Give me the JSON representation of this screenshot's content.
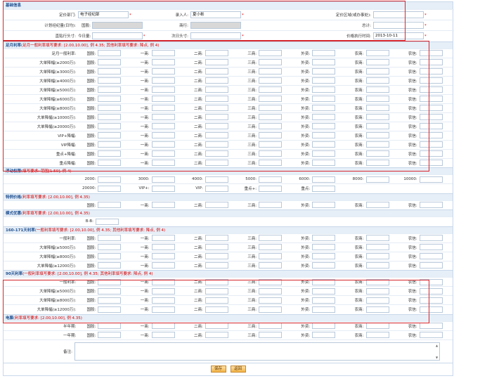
{
  "base": {
    "title": "基础信息",
    "row1": {
      "dept_label": "定价部门:",
      "dept_value": "电子经纪部",
      "entry_label": "录入人:",
      "entry_value": "夏小彬",
      "region_label": "定价区域(或办事处):",
      "region_value": ""
    },
    "row2": {
      "plan_label": "计划经纪量(日均):",
      "country_label": "国股:",
      "city_label": "商行:",
      "total_label": "总计:"
    },
    "row3": {
      "head_label": "直贴行头寸:",
      "today_label": "今日量:",
      "next_label": "次日头寸:",
      "date_label": "价格执行时间:",
      "date_value": "2013-10-11"
    }
  },
  "sections": {
    "month": {
      "title": "足月利率",
      "note": "(足月一般利率填写要求: [2.00,10.00], 例 4.35; 其他利率填写要求: 降点, 例 4)",
      "cols": [
        "国股:",
        "一商:",
        "二商:",
        "三商:",
        "外资:",
        "农商:",
        "农信:"
      ],
      "rows": [
        "足月一般利率:",
        "大单降幅(≥2000万):",
        "大单降幅(≥3000万):",
        "大单降幅(≥4000万):",
        "大单降幅(≥5000万):",
        "大单降幅(≥6000万):",
        "大单降幅(≥8000万):",
        "大单降幅(≥10000万):",
        "大单降幅(≥20000万):",
        "VIP+降幅:",
        "VIP降幅:",
        "重点+降幅:",
        "重点降幅:"
      ]
    },
    "float": {
      "title": "浮动权限",
      "note": "(填写要求: 范围[1.50], 例 4)",
      "row1": [
        "2000:",
        "3000:",
        "4000:",
        "5000:",
        "6000:",
        "8000:",
        "10000:"
      ],
      "row2": [
        "20000:",
        "VIP+:",
        "VIP:",
        "重点+:",
        "重点:"
      ]
    },
    "special": {
      "title": "特例价格",
      "note": "(利率填写要求: [2.00,10.00], 例 4.35)",
      "cols": [
        "国股:",
        "一商:",
        "二商:",
        "三商:",
        "外资:",
        "农商:",
        "农信:"
      ]
    },
    "mode": {
      "title": "模式优惠",
      "note": "(利率填写要求: [2.00,10.00], 例 4.35)",
      "label": "B-B:"
    },
    "d160": {
      "title": "160-171天利率",
      "note": "(一般利率填写要求: [2.00,10.00], 例 4.35; 其他利率填写要求: 降点, 例 4)",
      "cols": [
        "国股:",
        "一商:",
        "二商:",
        "三商:",
        "外资:",
        "农商:",
        "农信:"
      ],
      "rows": [
        "一般利率:",
        "大单降幅(≥5000万):",
        "大单降幅(≥8000万):",
        "大单降幅(≥12000万):"
      ]
    },
    "d90": {
      "title": "90天利率",
      "note": "(一般利率填写要求: [2.00,10.00], 例 4.35; 其他利率填写要求: 降点, 例 4)",
      "cols": [
        "国股:",
        "一商:",
        "二商:",
        "三商:",
        "外资:",
        "农商:",
        "农信:"
      ],
      "rows": [
        "一般利率:",
        "大单降幅(≥5000万):",
        "大单降幅(≥8000万):",
        "大单降幅(≥12000万):"
      ]
    },
    "epaper": {
      "title": "电票",
      "note": "(利率填写要求: [2.00,10.00], 例 4.35)",
      "cols": [
        "国股:",
        "一商:",
        "二商:",
        "三商:",
        "外资:",
        "农商:",
        "农信:"
      ],
      "rows": [
        "半年期:",
        "一年期:"
      ]
    }
  },
  "remark_label": "备注:",
  "buttons": {
    "save": "保存",
    "back": "返回"
  },
  "required_mark": "*",
  "colors": {
    "section_bg": "#e6eef7",
    "section_text": "#1f4f8f",
    "note": "#d40000",
    "highlight": "#d7262e"
  }
}
